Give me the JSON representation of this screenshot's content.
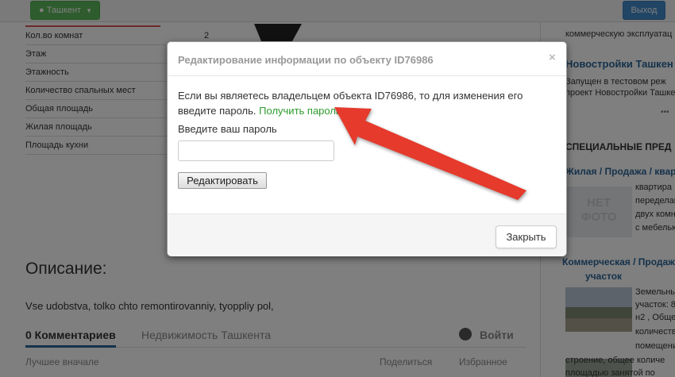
{
  "topbar": {
    "city_label": "Ташкент",
    "logout_label": "Выход"
  },
  "properties": [
    {
      "label": "Кол.во комнат",
      "value": "2"
    },
    {
      "label": "Этаж",
      "value": ""
    },
    {
      "label": "Этажность",
      "value": ""
    },
    {
      "label": "Количество спальных мест",
      "value": ""
    },
    {
      "label": "Общая площадь",
      "value": ""
    },
    {
      "label": "Жилая площадь",
      "value": ""
    },
    {
      "label": "Площадь кухни",
      "value": ""
    }
  ],
  "description": {
    "title": "Описание:",
    "text": "Vse udobstva, tolko chto remontirovanniy, tyoppliy pol,"
  },
  "comments": {
    "tab_active": "0 Комментариев",
    "tab_other": "Недвижимость Ташкента",
    "login": "Войти",
    "sort": "Лучшее вначале",
    "share": "Поделиться",
    "favorite": "Избранное"
  },
  "sidebar": {
    "line1": "коммерческую эксплуатац",
    "news_title": "Новостройки Ташкен",
    "news_line1": "Запущен в тестовом реж",
    "news_line2": "проект Новостройки Ташке",
    "special_heading": "СПЕЦИАЛЬНЫЕ ПРЕД",
    "cat1": "Жилая / Продажа / квар",
    "nophoto_line1": "НЕТ",
    "nophoto_line2": "ФОТО",
    "item1_lines": [
      "квартира",
      "переделан",
      "двух комн",
      "с мебелью"
    ],
    "cat2_line1": "Коммерческая / Продаж",
    "cat2_line2": "участок",
    "item2_lines": [
      "Земельны",
      "участок: 8",
      "н2 , Общее",
      "количеств",
      "помещени",
      "строение, общее количе",
      "площадью занятой по"
    ]
  },
  "modal": {
    "title": "Редактирование информации по объекту ID76986",
    "body_text": "Если вы являетесь владельцем объекта ID76986, то для изменения его введите пароль.",
    "get_password_link": "Получить пароль",
    "password_label": "Введите ваш пароль",
    "password_value": "",
    "edit_button": "Редактировать",
    "close_button": "Закрыть"
  },
  "colors": {
    "arrow": "#e53a2c",
    "link_green": "#2e9b2e",
    "city_button": "#5cb85c",
    "logout_button": "#428bca"
  }
}
